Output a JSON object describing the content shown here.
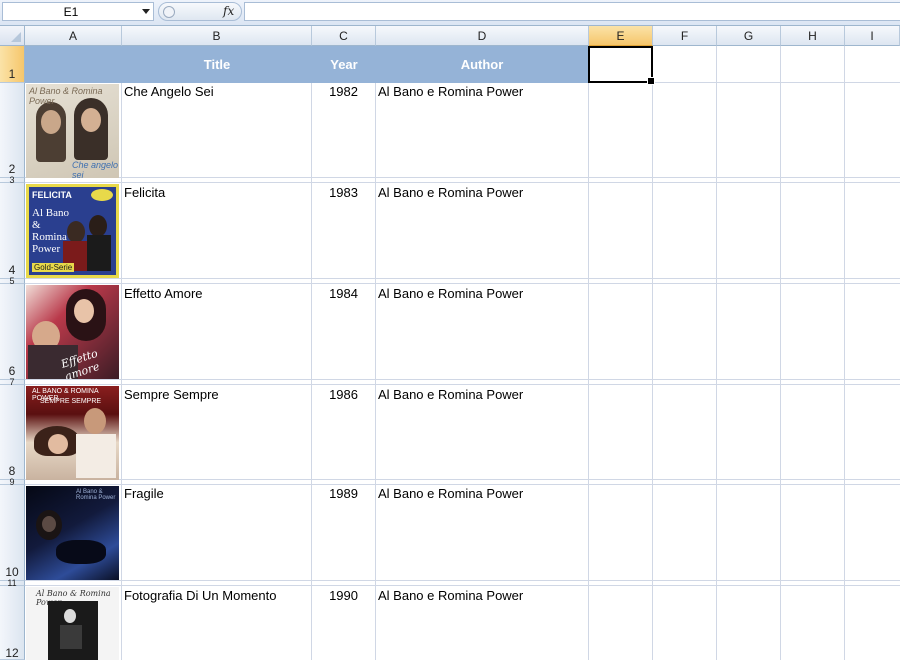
{
  "formula_bar": {
    "name_box": "E1",
    "fx_label": "fx",
    "formula": ""
  },
  "columns": [
    "A",
    "B",
    "C",
    "D",
    "E",
    "F",
    "G",
    "H",
    "I"
  ],
  "selected_cell": "E1",
  "header_row": {
    "row_number": "1",
    "title": "Title",
    "year": "Year",
    "author": "Author"
  },
  "rows": [
    {
      "row_number": "2",
      "hidden_after": "3",
      "title": "Che Angelo Sei",
      "year": "1982",
      "author": "Al Bano e Romina Power",
      "cover": {
        "lettering": "Al Bano & Romina Power",
        "lettering2": "Che angelo sei",
        "colors": [
          "#d9d3c4",
          "#6b5e4f"
        ]
      }
    },
    {
      "row_number": "4",
      "hidden_after": "5",
      "title": "Felicita",
      "year": "1983",
      "author": "Al Bano e Romina Power",
      "cover": {
        "lettering": "FELICITA",
        "lettering2": "Al Bano & Romina Power",
        "lettering3": "Gold-Serie",
        "colors": [
          "#2a3f8f",
          "#e8d94a"
        ]
      }
    },
    {
      "row_number": "6",
      "hidden_after": "7",
      "title": "Effetto Amore",
      "year": "1984",
      "author": "Al Bano e Romina Power",
      "cover": {
        "lettering": "Effetto amore",
        "colors": [
          "#9b1c2b",
          "#2b1a22"
        ]
      }
    },
    {
      "row_number": "8",
      "hidden_after": "9",
      "title": "Sempre Sempre",
      "year": "1986",
      "author": "Al Bano e Romina Power",
      "cover": {
        "lettering": "AL BANO & ROMINA POWER",
        "lettering2": "SEMPRE SEMPRE",
        "colors": [
          "#7a1718",
          "#e9d9c8"
        ]
      }
    },
    {
      "row_number": "10",
      "hidden_after": "11",
      "title": "Fragile",
      "year": "1989",
      "author": "Al Bano e Romina Power",
      "cover": {
        "lettering": "Al Bano & Romina Power",
        "colors": [
          "#0d1330",
          "#3a5aa8"
        ]
      }
    },
    {
      "row_number": "12",
      "hidden_after": "",
      "title": "Fotografia Di Un Momento",
      "year": "1990",
      "author": "Al Bano e Romina Power",
      "cover": {
        "lettering": "Al Bano & Romina Power",
        "colors": [
          "#f4f4f4",
          "#111111"
        ]
      }
    }
  ]
}
